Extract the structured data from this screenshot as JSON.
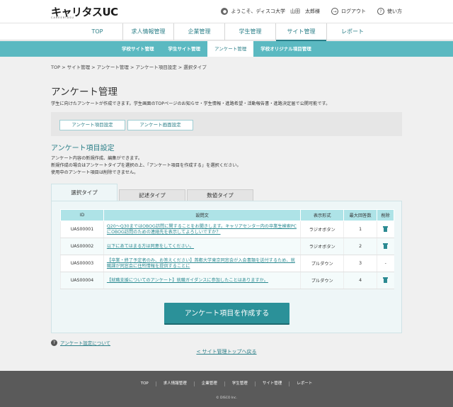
{
  "header": {
    "logo": "キャリタスUC",
    "logo_sub": "CAREERTASU",
    "welcome": "ようこそ、ディスコ大学　山田　太郎様",
    "logout": "ログアウト",
    "help": "使い方"
  },
  "gnav": [
    "TOP",
    "求人情報管理",
    "企業管理",
    "学生管理",
    "サイト管理",
    "レポート"
  ],
  "subnav": [
    "学校サイト管理",
    "学生サイト管理",
    "アンケート管理",
    "学校オリジナル項目管理"
  ],
  "breadcrumb": "TOP > サイト管理 > アンケート管理 > アンケート項目設定 > 選択タイプ",
  "page": {
    "title": "アンケート管理",
    "description": "学生に向けたアンケートが作成できます。学生画面のTOPページのお知らせ・学生情報・進路希望・活動報告書・進路決定届で公開可能です。"
  },
  "buttons": {
    "item_setting": "アンケート項目設定",
    "screen_setting": "アンケート画面設定",
    "create": "アンケート項目を作成する"
  },
  "section": {
    "title": "アンケート項目設定",
    "desc1": "アンケート内容の新規作成、編集ができます。",
    "desc2": "新規作成の場合はアンケートタイプを選択の上、「アンケート項目を作成する」を選択ください。",
    "desc3": "使用中のアンケート項目は削除できません。"
  },
  "tabs": [
    "選択タイプ",
    "記述タイプ",
    "数値タイプ"
  ],
  "table": {
    "headers": [
      "ID",
      "設問文",
      "表示形式",
      "最大回答数",
      "削除"
    ],
    "rows": [
      {
        "id": "UAS00001",
        "text": "Q20～Q30まではOBOG訪問に関することをお聞きします。キャリアセンター内の卒業生検索PCにOBOG訪問のための連絡先を表示してよろしいですか？",
        "format": "ラジオボタン",
        "max": "1",
        "delete": "trash"
      },
      {
        "id": "UAS00002",
        "text": "以下にあてはまる方は同意をしてください。",
        "format": "ラジオボタン",
        "max": "2",
        "delete": "trash"
      },
      {
        "id": "UAS00003",
        "text": "【卒業・終了予定者のみ、お答えください】首都大学東京同窓会が入会書類を送付するため、就職課が同窓会に住所情報を提供することに",
        "format": "プルダウン",
        "max": "3",
        "delete": "-"
      },
      {
        "id": "UAS00004",
        "text": "【就職支援についてのアンケート】就職ガイダンスに参加したことはありますか。",
        "format": "プルダウン",
        "max": "4",
        "delete": "trash"
      }
    ]
  },
  "help_link": "アンケート設定について",
  "back_link": "< サイト管理トップへ戻る",
  "footer": {
    "links": [
      "TOP",
      "求人情報管理",
      "企業管理",
      "学生管理",
      "サイト管理",
      "レポート"
    ],
    "copyright": "© DISCO Inc."
  },
  "colors": {
    "accent": "#2b9199",
    "subnav": "#5bb9c1",
    "table_header": "#aee3e7"
  }
}
